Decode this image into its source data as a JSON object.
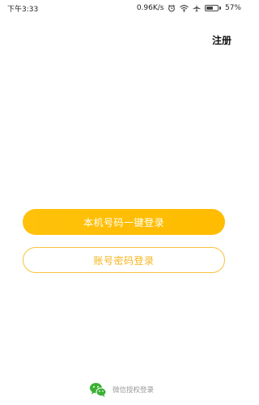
{
  "status_bar": {
    "time": "下午3:33",
    "network_speed": "0.96K/s",
    "battery_percent": "57%",
    "battery_level": 0.57,
    "icons": [
      "alarm-icon",
      "wifi-icon",
      "airplane-icon",
      "battery-icon"
    ]
  },
  "header": {
    "register_label": "注册"
  },
  "actions": {
    "one_click_login_label": "本机号码一键登录",
    "password_login_label": "账号密码登录"
  },
  "wechat": {
    "label": "微信授权登录",
    "icon": "wechat-icon"
  },
  "colors": {
    "primary": "#ffbf00",
    "outline": "#f8c23d",
    "wechat_green": "#3cb034"
  }
}
